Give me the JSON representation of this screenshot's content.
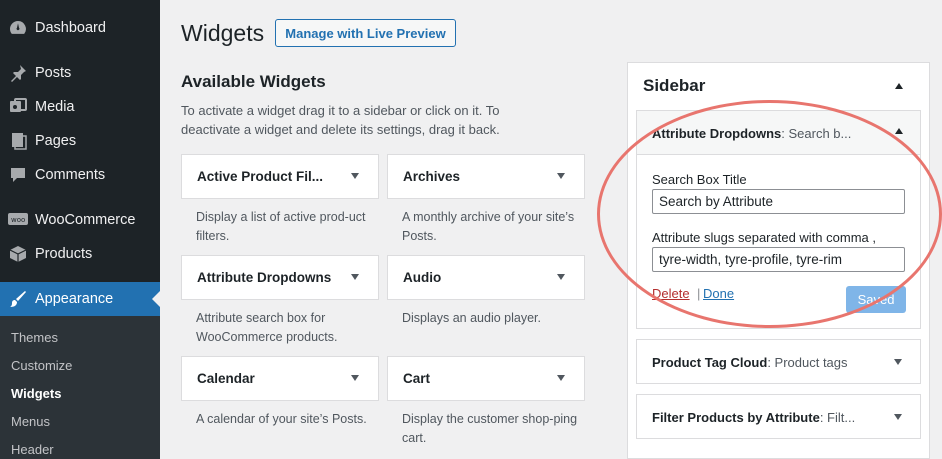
{
  "admin_menu": {
    "items": [
      {
        "label": "Dashboard",
        "icon": "dashboard-icon"
      },
      {
        "label": "Posts",
        "icon": "pin-icon"
      },
      {
        "label": "Media",
        "icon": "media-icon"
      },
      {
        "label": "Pages",
        "icon": "pages-icon"
      },
      {
        "label": "Comments",
        "icon": "comment-icon"
      },
      {
        "label": "WooCommerce",
        "icon": "woo-icon"
      },
      {
        "label": "Products",
        "icon": "box-icon"
      },
      {
        "label": "Appearance",
        "icon": "brush-icon"
      }
    ],
    "submenu": [
      "Themes",
      "Customize",
      "Widgets",
      "Menus",
      "Header"
    ],
    "current": "Appearance",
    "current_sub": "Widgets"
  },
  "header": {
    "title": "Widgets",
    "live_preview_label": "Manage with Live Preview"
  },
  "available": {
    "heading": "Available Widgets",
    "description": "To activate a widget drag it to a sidebar or click on it. To deactivate a widget and delete its settings, drag it back.",
    "widgets": [
      {
        "title": "Active Product Fil...",
        "desc": "Display a list of active prod-uct filters."
      },
      {
        "title": "Archives",
        "desc": "A monthly archive of your site’s Posts."
      },
      {
        "title": "Attribute Dropdowns",
        "desc": "Attribute search box for WooCommerce products."
      },
      {
        "title": "Audio",
        "desc": "Displays an audio player."
      },
      {
        "title": "Calendar",
        "desc": "A calendar of your site’s Posts."
      },
      {
        "title": "Cart",
        "desc": "Display the customer shop-ping cart."
      }
    ]
  },
  "sidebar": {
    "title": "Sidebar",
    "expanded_widget": {
      "title": "Attribute Dropdowns",
      "subtitle": ": Search b...",
      "field1_label": "Search Box Title",
      "field1_value": "Search by Attribute",
      "field2_label": "Attribute slugs separated with comma ,",
      "field2_value": "tyre-width, tyre-profile, tyre-rim",
      "delete_label": "Delete",
      "separator": "|",
      "done_label": "Done",
      "saved_label": "Saved"
    },
    "widgets": [
      {
        "title": "Product Tag Cloud",
        "subtitle": ": Product tags"
      },
      {
        "title": "Filter Products by Attribute",
        "subtitle": ": Filt..."
      }
    ]
  },
  "colors": {
    "menu_bg": "#1d2327",
    "accent": "#2271b1",
    "annotation": "#e8756e"
  }
}
